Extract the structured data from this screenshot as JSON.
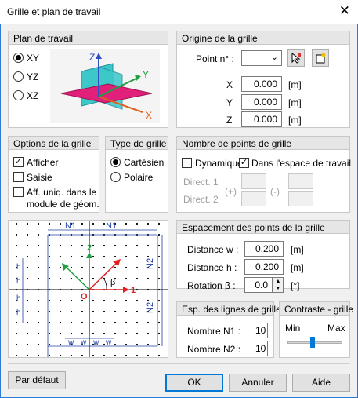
{
  "window": {
    "title": "Grille et plan de travail",
    "close_icon": "close-icon"
  },
  "plan": {
    "title": "Plan de travail",
    "options": [
      "XY",
      "YZ",
      "XZ"
    ],
    "selected": "XY",
    "axis_labels": {
      "x": "X",
      "y": "Y",
      "z": "Z"
    }
  },
  "origine": {
    "title": "Origine de la grille",
    "point_label": "Point n° :",
    "point_value": "",
    "x_label": "X",
    "x_value": "0.000",
    "y_label": "Y",
    "y_value": "0.000",
    "z_label": "Z",
    "z_value": "0.000",
    "unit": "[m]"
  },
  "options_grille": {
    "title": "Options de la grille",
    "afficher": "Afficher",
    "afficher_checked": true,
    "saisie": "Saisie",
    "saisie_checked": false,
    "aff_line1": "Aff. uniq. dans le",
    "aff_line2": "module de géom.",
    "aff_checked": false
  },
  "type_grille": {
    "title": "Type de grille",
    "cartesien": "Cartésien",
    "polaire": "Polaire",
    "selected": "Cartésien"
  },
  "nombre_points": {
    "title": "Nombre de points de grille",
    "dynamique": "Dynamique",
    "dynamique_checked": false,
    "espace": "Dans l'espace de travail",
    "espace_checked": true,
    "direct1": "Direct. 1",
    "direct2": "Direct. 2",
    "plus": "(+)",
    "minus": "(-)"
  },
  "diagram": {
    "n1": "N1",
    "n2": "N2",
    "h": "h",
    "w": "w",
    "o": "O",
    "axis1": "1",
    "axis2": "2",
    "beta": "β"
  },
  "espacement": {
    "title": "Espacement des points de la grille",
    "dist_w_label": "Distance w :",
    "dist_w_value": "0.200",
    "dist_h_label": "Distance h :",
    "dist_h_value": "0.200",
    "rotation_label": "Rotation β :",
    "rotation_value": "0.0",
    "unit_m": "[m]",
    "unit_deg": "[°]"
  },
  "esp_lignes": {
    "title": "Esp. des lignes de grille",
    "n1_label": "Nombre N1 :",
    "n1_value": "10",
    "n2_label": "Nombre N2 :",
    "n2_value": "10"
  },
  "contraste": {
    "title": "Contraste - grille",
    "min": "Min",
    "max": "Max",
    "level": 0.45
  },
  "buttons": {
    "default": "Par défaut",
    "ok": "OK",
    "cancel": "Annuler",
    "help": "Aide"
  }
}
